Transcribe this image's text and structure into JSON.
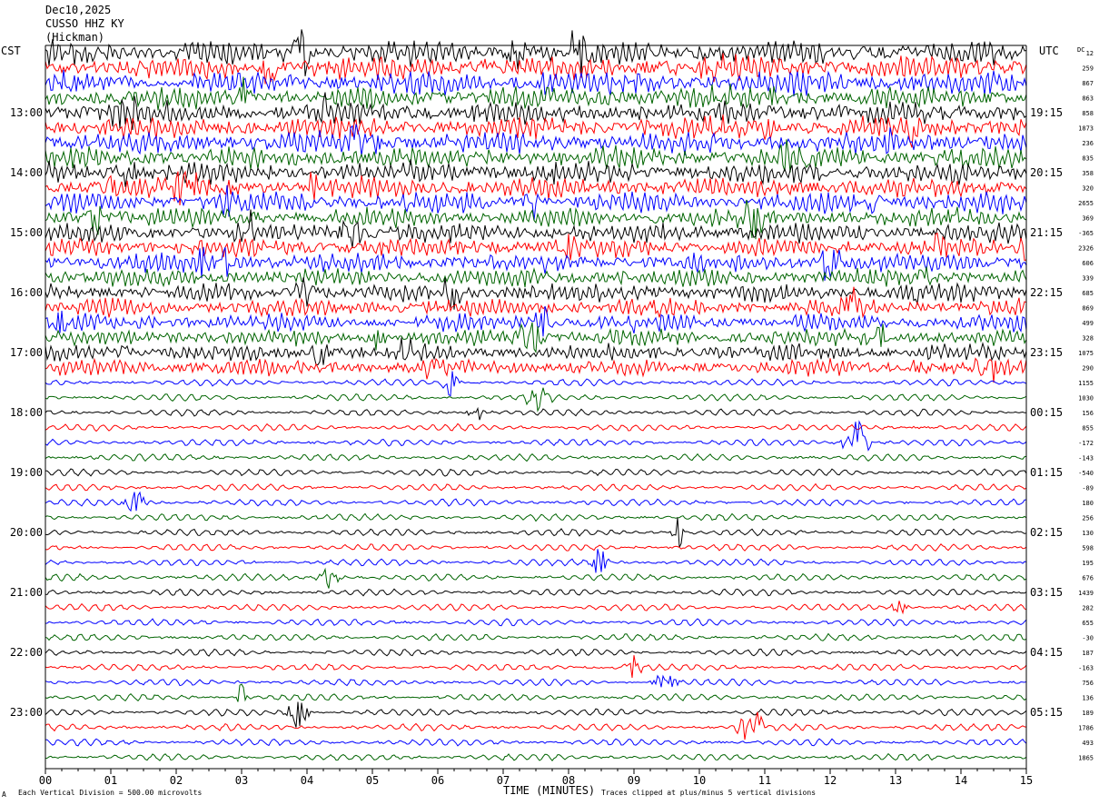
{
  "header": {
    "date": "Dec10,2025",
    "station": "CUSSO HHZ KY",
    "location": "(Hickman)"
  },
  "axis_labels": {
    "left_timezone": "CST",
    "right_timezone": "UTC",
    "dc_label": "DC"
  },
  "footer": {
    "scale_note": "Each Vertical Division =  500.00 microvolts",
    "clip_note": "Traces clipped at plus/minus 5 vertical divisions",
    "corner_mark": "A"
  },
  "chart_data": {
    "type": "line",
    "title": "Dec10,2025",
    "xlabel": "TIME (MINUTES)",
    "ylabel": "",
    "xlim": [
      0,
      15
    ],
    "x_ticks": [
      "00",
      "01",
      "02",
      "03",
      "04",
      "05",
      "06",
      "07",
      "08",
      "09",
      "10",
      "11",
      "12",
      "13",
      "14",
      "15"
    ],
    "left_hour_labels": [
      "13:00",
      "14:00",
      "15:00",
      "16:00",
      "17:00",
      "18:00",
      "19:00",
      "20:00",
      "21:00",
      "22:00",
      "23:00"
    ],
    "right_hour_labels": [
      "19:15",
      "20:15",
      "21:15",
      "22:15",
      "23:15",
      "00:15",
      "01:15",
      "02:15",
      "03:15",
      "04:15",
      "05:15"
    ],
    "trace_colors": [
      "#000000",
      "#ff0000",
      "#0000ff",
      "#006400"
    ],
    "traces_per_hour": 4,
    "trace_count": 48,
    "dc_offsets": [
      "12",
      "259",
      "867",
      "863",
      "858",
      "1873",
      "236",
      "835",
      "358",
      "320",
      "2655",
      "369",
      "-365",
      "2326",
      "606",
      "339",
      "685",
      "869",
      "499",
      "328",
      "1075",
      "290",
      "1155",
      "1030",
      "156",
      "855",
      "-172",
      "-143",
      "-540",
      "-89",
      "180",
      "256",
      "130",
      "598",
      "195",
      "676",
      "1439",
      "282",
      "655",
      "-30",
      "187",
      "-163",
      "756",
      "136",
      "189",
      "1786",
      "493",
      "1865"
    ]
  }
}
